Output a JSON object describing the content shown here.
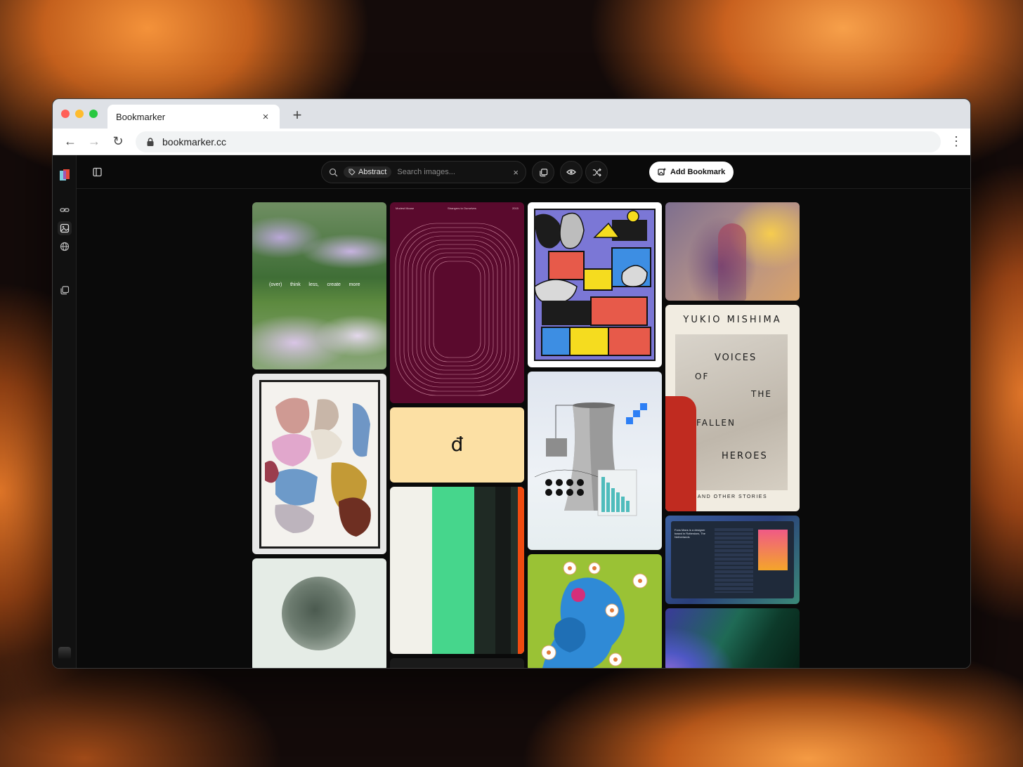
{
  "browser": {
    "tab_title": "Bookmarker",
    "close_glyph": "×",
    "newtab_glyph": "+",
    "url": "bookmarker.cc",
    "back_glyph": "←",
    "forward_glyph": "→",
    "reload_glyph": "↻",
    "menu_glyph": "⋮"
  },
  "app": {
    "search": {
      "tag_label": "Abstract",
      "placeholder": "Search images...",
      "clear_glyph": "×"
    },
    "add_bookmark_label": "Add Bookmark"
  },
  "cards": {
    "poster_text": "(over)      think      less,      create      more",
    "album_header_left": "Modest Mouse",
    "album_header_center": "Strangers to Ourselves",
    "album_header_right": "2015",
    "glyph_char": "đ",
    "book_author": "YUKIO MISHIMA",
    "book_line1": "VOICES",
    "book_line2": "OF",
    "book_line3": "THE",
    "book_line4": "FALLEN",
    "book_line5": "HEROES",
    "book_subtitle": "AND OTHER STORIES",
    "site_intro": "Fons Mans is a designer based in Rotterdam, The Netherlands"
  },
  "icons": {
    "rail": [
      "bookmarker-logo-icon",
      "link-icon",
      "image-icon",
      "globe-icon",
      "collections-icon"
    ],
    "toolbar": [
      "sidebar-toggle-icon",
      "search-icon",
      "tag-icon",
      "collections-icon",
      "eye-icon",
      "shuffle-icon",
      "add-image-icon"
    ]
  },
  "colors": {
    "accent_white": "#ffffff",
    "app_bg": "#0a0a0a"
  }
}
